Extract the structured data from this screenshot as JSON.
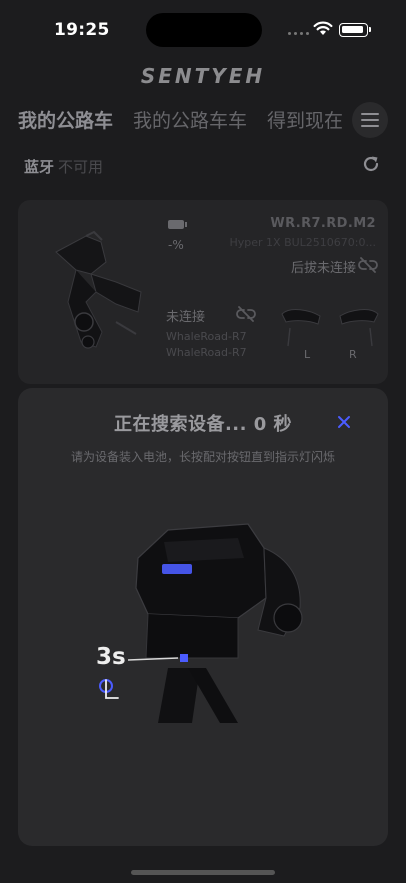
{
  "status_bar": {
    "time": "19:25"
  },
  "brand": {
    "logo_text": "SENTYEH"
  },
  "tabs": [
    {
      "label": "我的公路车",
      "active": true
    },
    {
      "label": "我的公路车车",
      "active": false
    },
    {
      "label": "得到现在",
      "active": false
    }
  ],
  "bluetooth": {
    "label": "蓝牙",
    "state": "不可用"
  },
  "bike_card": {
    "battery_percent": "-%",
    "model": "WR.R7.RD.M2",
    "serial": "Hyper 1X BUL2510670:0...",
    "rear_status": "后拔未连接",
    "shifter_status": "未连接",
    "shifter_name_1": "WhaleRoad-R7",
    "shifter_name_2": "WhaleRoad-R7",
    "left_label": "L",
    "right_label": "R"
  },
  "pairing_sheet": {
    "title": "正在搜索设备... 0 秒",
    "hint": "请为设备装入电池，长按配对按钮直到指示灯闪烁",
    "press_duration": "3s"
  },
  "colors": {
    "accent": "#4b5cff",
    "background": "#1c1c1e",
    "card": "#252527",
    "sheet": "#2a2a2c"
  }
}
